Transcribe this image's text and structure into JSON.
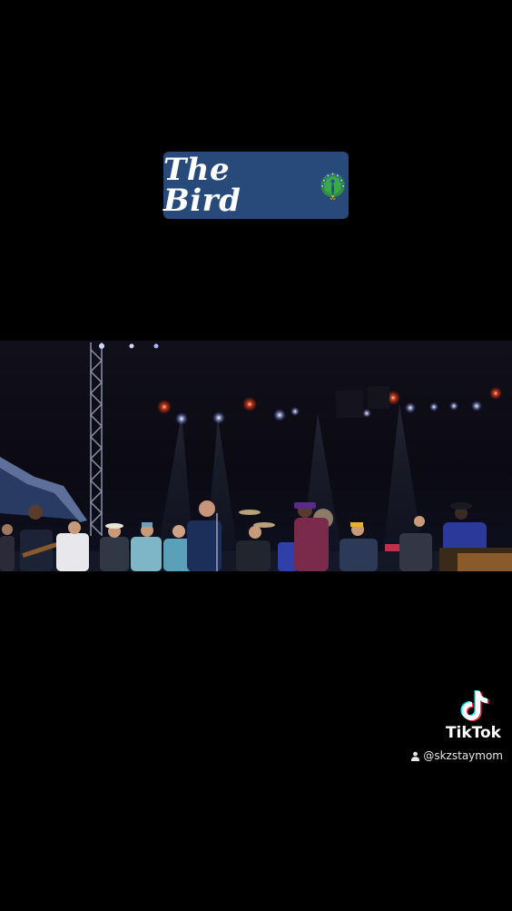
{
  "title_card": {
    "text": "The Bird",
    "emoji": "peacock-icon",
    "background": "#284a7a"
  },
  "watermark": {
    "brand": "TikTok",
    "handle": "@skzstaymom",
    "icon": "tiktok-logo-icon"
  }
}
